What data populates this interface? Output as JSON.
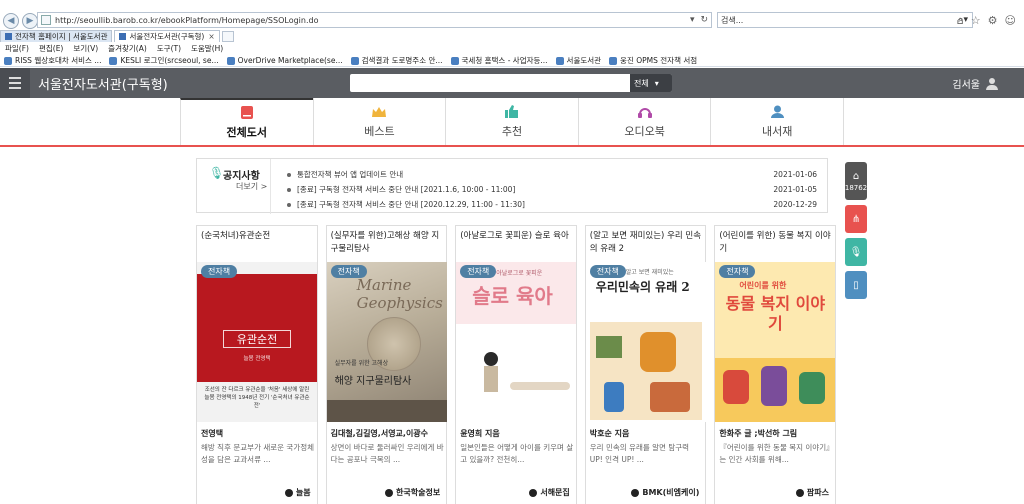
{
  "browser": {
    "url": "http://seoullib.barob.co.kr/ebookPlatform/Homepage/SSOLogin.do",
    "search_placeholder": "검색...",
    "tabs": [
      {
        "label": "전자책 홈페이지 | 서울도서관"
      },
      {
        "label": "서울전자도서관(구독형)"
      }
    ],
    "menu": [
      "파일(F)",
      "편집(E)",
      "보기(V)",
      "즐겨찾기(A)",
      "도구(T)",
      "도움말(H)"
    ],
    "favorites": [
      "RISS 웹상호대차 서비스 ...",
      "KESLI 로그인(srcseoul, se...",
      "OverDrive Marketplace(se...",
      "검색결과  도로명주소 안...",
      "국세청 홈택스 - 사업자등...",
      "서울도서관",
      "웅진 OPMS 전자책 서점"
    ]
  },
  "header": {
    "title": "서울전자도서관(구독형)",
    "search_scope": "전체",
    "user_name": "김서울"
  },
  "categories": [
    {
      "label": "전체도서",
      "icon": "book-icon"
    },
    {
      "label": "베스트",
      "icon": "crown-icon"
    },
    {
      "label": "추천",
      "icon": "thumbs-up-icon"
    },
    {
      "label": "오디오북",
      "icon": "headphones-icon"
    },
    {
      "label": "내서재",
      "icon": "user-icon"
    }
  ],
  "notice": {
    "title": "공지사항",
    "more": "더보기 >",
    "items": [
      {
        "text": "통합전자책 뷰어 앱 업데이트 안내",
        "date": "2021-01-06"
      },
      {
        "text": "[종료] 구독형 전자책 서비스 중단 안내 [2021.1.6, 10:00 - 11:00]",
        "date": "2021-01-05"
      },
      {
        "text": "[종료] 구독형 전자책 서비스 중단 안내 [2020.12.29, 11:00 - 11:30]",
        "date": "2020-12-29"
      }
    ]
  },
  "books": [
    {
      "title": "(순국처녀)유관순전",
      "badge": "전자책",
      "cover_title": "유관순전",
      "cover_sub": "늘봄 전영택",
      "cover_caption": "조선의 잔 다르크 유관순을 '처음' 세상에 알린 늘봄 전영택의 1948년 전기 '순국처녀 유관순전'",
      "author": "전영택",
      "desc": "해방 직후 문교부가 새로운 국가정체성을 담은 교과서류 ...",
      "publisher": "늘봄"
    },
    {
      "title": "(실무자를 위한)고해상 해양 지구물리탐사",
      "badge": "전자책",
      "cover_title": "Marine Geophysics",
      "cover_sub": "실무자를 위한 고해상",
      "cover_main": "해양 지구물리탐사",
      "author": "김대철,김길영,서영교,이광수",
      "desc": "상면이 바다로 둘러싸인 우리에게 바다는 공포나 극복의 ...",
      "publisher": "한국학술정보"
    },
    {
      "title": "(아날로그로 꽃피운) 슬로 육아",
      "badge": "전자책",
      "cover_top": "아날로그로 꽃피운",
      "cover_title": "슬로 육아",
      "author": "윤영희 지음",
      "desc": "일본인들은 어떻게 아이를 키우며 살고 있을까? 전천히...",
      "publisher": "서해문집"
    },
    {
      "title": "(알고 보면 재미있는) 우리 민속의 유래 2",
      "badge": "전자책",
      "cover_top": "알고 보면 재미있는",
      "cover_title": "우리민속의 유래 2",
      "author": "박호순 지음",
      "desc": "우리 민속의 유래를 알면 탐구력 UP! 인격 UP! ...",
      "publisher": "BMK(비엠케이)"
    },
    {
      "title": "(어린이를 위한) 동물 복지 이야기",
      "badge": "전자책",
      "cover_top": "어린이를 위한",
      "cover_title": "동물 복지 이야기",
      "author": "한화주 글 ;박선하 그림",
      "desc": "『어린이를 위한 동물 복지 이야기』는 인간 사회를 위해...",
      "publisher": "팜파스"
    }
  ],
  "side_tools": {
    "count": "18762"
  },
  "colors": {
    "accent": "#e8524f",
    "header_bg": "#5a5d62",
    "teal": "#3fb6a4",
    "badge": "#4f7fa3"
  }
}
